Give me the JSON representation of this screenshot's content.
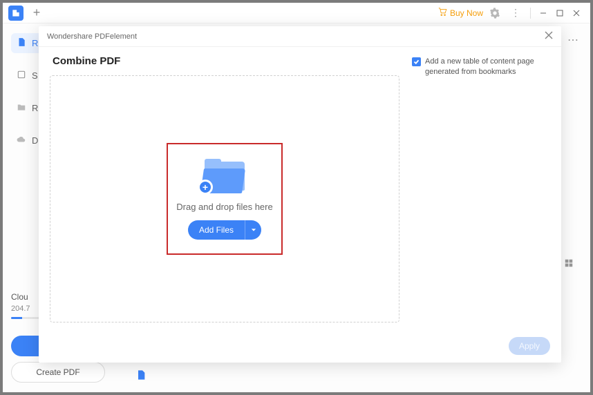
{
  "titlebar": {
    "buy_now": "Buy Now"
  },
  "sidebar": {
    "items": [
      {
        "label": "R"
      },
      {
        "label": "S"
      },
      {
        "label": "R"
      },
      {
        "label": "D"
      }
    ],
    "cloud_label": "Clou",
    "cloud_size": "204.7",
    "create_pdf": "Create PDF"
  },
  "modal": {
    "window_title": "Wondershare PDFelement",
    "heading": "Combine PDF",
    "drop_hint": "Drag and drop files here",
    "add_files": "Add Files",
    "checkbox_label": "Add a new table of content page generated from bookmarks",
    "apply": "Apply"
  }
}
